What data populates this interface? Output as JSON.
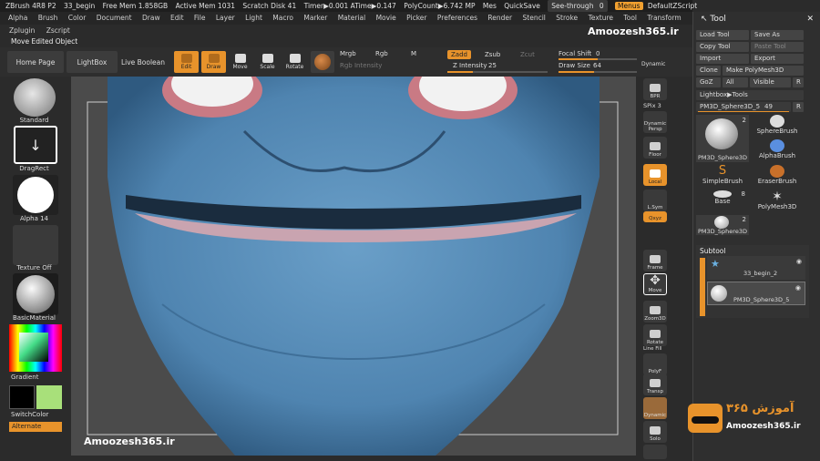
{
  "titlebar": {
    "app": "ZBrush 4R8 P2",
    "doc": "33_begin",
    "free_mem": "Free Mem 1.858GB",
    "active_mem": "Active Mem 1031",
    "scratch": "Scratch Disk 41",
    "timer": "Timer▶0.001 ATime▶0.147",
    "polycount": "PolyCount▶6.742 MP",
    "mes": "Mes",
    "quicksave": "QuickSave",
    "seethrough": "See-through",
    "seethrough_val": "0",
    "menus": "Menus",
    "defaultscript": "DefaultZScript"
  },
  "menubar": [
    "Alpha",
    "Brush",
    "Color",
    "Document",
    "Draw",
    "Edit",
    "File",
    "Layer",
    "Light",
    "Macro",
    "Marker",
    "Material",
    "Movie",
    "Picker",
    "Preferences",
    "Render",
    "Stencil",
    "Stroke",
    "Texture",
    "Tool",
    "Transform"
  ],
  "menubar2": [
    "Zplugin",
    "Zscript"
  ],
  "status_text": "Move Edited Object",
  "toolbar": {
    "home": "Home Page",
    "lightbox": "LightBox",
    "live_boolean": "Live Boolean",
    "edit": "Edit",
    "draw": "Draw",
    "move": "Move",
    "scale": "Scale",
    "rotate": "Rotate",
    "mrgb": "Mrgb",
    "rgb": "Rgb",
    "m": "M",
    "rgb_intensity": "Rgb Intensity",
    "zadd": "Zadd",
    "zsub": "Zsub",
    "zcut": "Zcut",
    "z_intensity": "Z Intensity",
    "z_intensity_val": "25",
    "focal_shift": "Focal Shift",
    "focal_shift_val": "0",
    "draw_size": "Draw Size",
    "draw_size_val": "64",
    "dynamic": "Dynamic"
  },
  "leftshelf": {
    "standard": "Standard",
    "dragrect": "DragRect",
    "alpha": "Alpha 14",
    "texture": "Texture Off",
    "material": "BasicMaterial",
    "gradient": "Gradient",
    "switchcolor": "SwitchColor",
    "alternate": "Alternate"
  },
  "rightshelf": {
    "bpr": "BPR",
    "spix": "SPix 3",
    "dynamic_persp": "Dynamic",
    "persp": "Persp",
    "floor": "Floor",
    "local": "Local",
    "lsym": "L.Sym",
    "qxyz": "Qxyz",
    "frame": "Frame",
    "move": "Move",
    "zoom3d": "Zoom3D",
    "rotate": "Rotate",
    "linefill": "Line Fill",
    "polyf": "PolyF",
    "transp": "Transp",
    "dynamic2": "Dynamic",
    "solo": "Solo"
  },
  "toolpalette": {
    "title": "Tool",
    "load_tool": "Load Tool",
    "save_as": "Save As",
    "copy_tool": "Copy Tool",
    "paste_tool": "Paste Tool",
    "import": "Import",
    "export": "Export",
    "clone": "Clone",
    "make_polymesh": "Make PolyMesh3D",
    "goz": "GoZ",
    "all": "All",
    "visible": "Visible",
    "r": "R",
    "lightbox_tools": "Lightbox▶Tools",
    "current_tool": "PM3D_Sphere3D_5",
    "current_tool_val": "49",
    "tools": [
      {
        "label": "PM3D_Sphere3D",
        "count": "2"
      },
      {
        "label": "SphereBrush",
        "count": ""
      },
      {
        "label": "AlphaBrush",
        "count": ""
      },
      {
        "label": "SimpleBrush",
        "count": ""
      },
      {
        "label": "EraserBrush",
        "count": ""
      },
      {
        "label": "Base",
        "count": "8"
      },
      {
        "label": "PolyMesh3D",
        "count": ""
      },
      {
        "label": "PM3D_Sphere3D",
        "count": "2"
      }
    ],
    "subtool": "Subtool",
    "subtools": [
      "33_begin_2",
      "PM3D_Sphere3D_5"
    ]
  },
  "watermark": {
    "top": "Amoozesh365.ir",
    "bottom_left": "Amoozesh365.ir",
    "logo_text": "آموزش ۳۶۵",
    "logo_url": "Amoozesh365.ir"
  }
}
